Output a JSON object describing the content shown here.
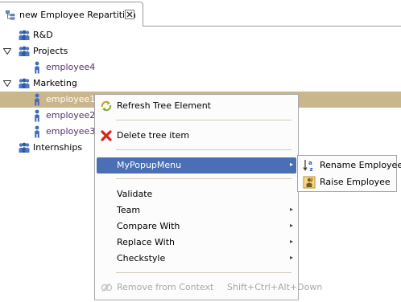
{
  "tab": {
    "title": "new Employee Repartition",
    "icon": "tree-editor-icon"
  },
  "tree": {
    "items": [
      {
        "label": "R&D",
        "kind": "group",
        "icon": "group-icon"
      },
      {
        "label": "Projects",
        "kind": "group",
        "icon": "group-icon",
        "expanded": true
      },
      {
        "label": "employee4",
        "kind": "employee",
        "icon": "person-icon"
      },
      {
        "label": "Marketing",
        "kind": "group",
        "icon": "group-icon",
        "expanded": true
      },
      {
        "label": "employee1",
        "kind": "employee",
        "icon": "person-icon",
        "selected": true
      },
      {
        "label": "employee2",
        "kind": "employee",
        "icon": "person-icon"
      },
      {
        "label": "employee3",
        "kind": "employee",
        "icon": "person-icon"
      },
      {
        "label": "Internships",
        "kind": "group",
        "icon": "group-icon"
      }
    ]
  },
  "context_menu": {
    "items": [
      {
        "label": "Refresh Tree Element",
        "icon": "refresh-icon"
      },
      {
        "label": "Delete tree item",
        "icon": "delete-icon"
      },
      {
        "label": "MyPopupMenu",
        "submenu": true,
        "highlighted": true
      },
      {
        "label": "Validate"
      },
      {
        "label": "Team",
        "submenu": true
      },
      {
        "label": "Compare With",
        "submenu": true
      },
      {
        "label": "Replace With",
        "submenu": true
      },
      {
        "label": "Checkstyle",
        "submenu": true
      },
      {
        "label": "Remove from Context",
        "accelerator": "Shift+Ctrl+Alt+Down",
        "disabled": true,
        "icon": "remove-context-icon"
      }
    ]
  },
  "submenu": {
    "items": [
      {
        "label": "Rename Employee",
        "icon": "sort-az-icon"
      },
      {
        "label": "Raise Employee",
        "icon": "raise-icon"
      }
    ]
  },
  "colors": {
    "selection": "#c9b68c",
    "menu_highlight": "#4a6fb5",
    "employee_text": "#5a2a74",
    "disabled_text": "#a8a8a8"
  }
}
